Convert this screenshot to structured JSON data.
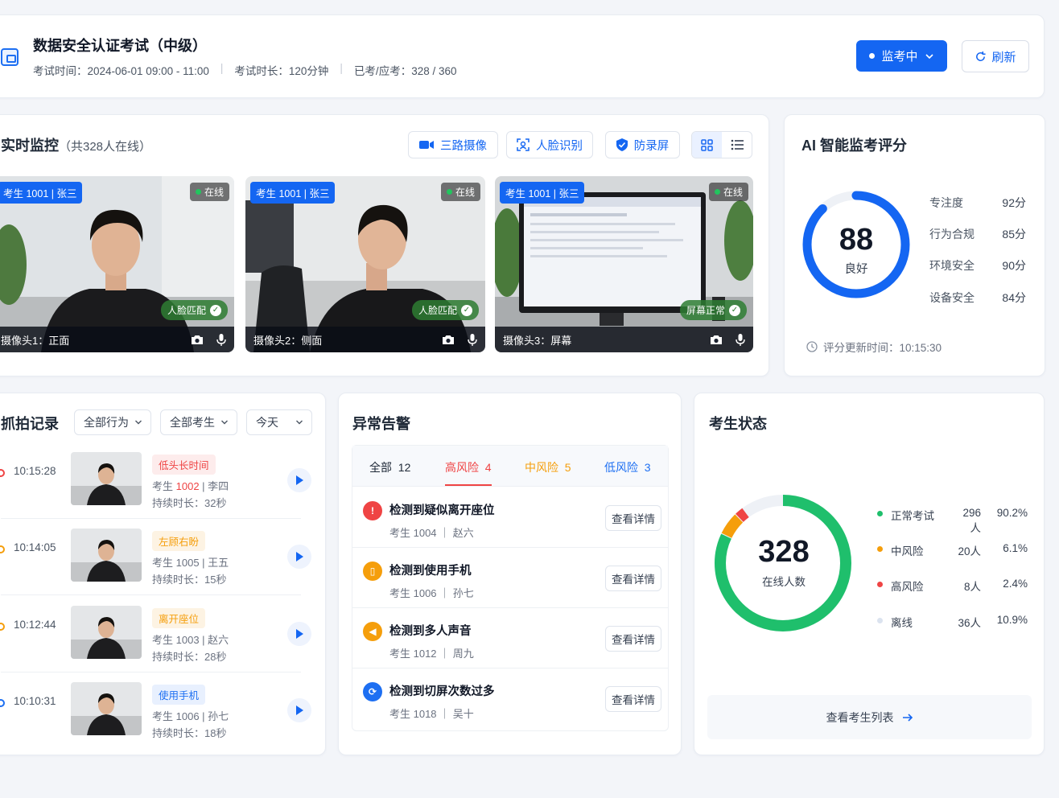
{
  "header": {
    "title": "数据安全认证考试（中级）",
    "meta": [
      "考试时间：2024-06-01 09:00 - 11:00",
      "考试时长：120分钟",
      "已考/应考：328 / 360"
    ],
    "status_label": "监考中",
    "refresh_label": "刷新"
  },
  "monitor": {
    "title": "实时监控",
    "subtitle": "（共328人在线）",
    "tools": [
      "三路摄像",
      "人脸识别",
      "防录屏"
    ],
    "cameras": [
      {
        "tag": "考生 1001 | 张三",
        "status": "在线",
        "check": "人脸匹配",
        "label": "摄像头1：正面"
      },
      {
        "tag": "考生 1001 | 张三",
        "status": "在线",
        "check": "人脸匹配",
        "label": "摄像头2：侧面"
      },
      {
        "tag": "考生 1001 | 张三",
        "status": "在线",
        "check": "屏幕正常",
        "label": "摄像头3：屏幕"
      }
    ]
  },
  "ai_score": {
    "title": "AI 智能监考评分",
    "score": "88",
    "score_value": 88,
    "grade": "良好",
    "items": [
      {
        "name": "专注度",
        "value": "92分"
      },
      {
        "name": "行为合规",
        "value": "85分"
      },
      {
        "name": "环境安全",
        "value": "90分"
      },
      {
        "name": "设备安全",
        "value": "84分"
      }
    ],
    "updated": "评分更新时间：10:15:30"
  },
  "snapshots": {
    "title": "抓拍记录",
    "filters": [
      "全部行为",
      "全部考生",
      "今天"
    ],
    "items": [
      {
        "time": "10:15:28",
        "badge": "低头长时间",
        "badge_color": "#ef4444",
        "badge_bg": "#fdecec",
        "dot_color": "#ef4444",
        "who_prefix": "考生 ",
        "id": "1002",
        "id_color": "#ef4444",
        "who_suffix": " | 李四",
        "duration": "持续时长：32秒"
      },
      {
        "time": "10:14:05",
        "badge": "左顾右盼",
        "badge_color": "#f59e0b",
        "badge_bg": "#fdf3e3",
        "dot_color": "#f59e0b",
        "who_prefix": "考生 ",
        "id": "1005",
        "id_color": "#6b7280",
        "who_suffix": " | 王五",
        "duration": "持续时长：15秒"
      },
      {
        "time": "10:12:44",
        "badge": "离开座位",
        "badge_color": "#f59e0b",
        "badge_bg": "#fdf3e3",
        "dot_color": "#f59e0b",
        "who_prefix": "考生 ",
        "id": "1003",
        "id_color": "#6b7280",
        "who_suffix": " | 赵六",
        "duration": "持续时长：28秒"
      },
      {
        "time": "10:10:31",
        "badge": "使用手机",
        "badge_color": "#1d6ff2",
        "badge_bg": "#e8f0fe",
        "dot_color": "#1d6ff2",
        "who_prefix": "考生 ",
        "id": "1006",
        "id_color": "#6b7280",
        "who_suffix": " | 孙七",
        "duration": "持续时长：18秒"
      }
    ]
  },
  "alerts": {
    "title": "异常告警",
    "tabs": [
      {
        "label": "全部",
        "count": "12",
        "color": "#111827"
      },
      {
        "label": "高风险",
        "count": "4",
        "color": "#ef4444"
      },
      {
        "label": "中风险",
        "count": "5",
        "color": "#f59e0b"
      },
      {
        "label": "低风险",
        "count": "3",
        "color": "#1d6ff2"
      }
    ],
    "items": [
      {
        "title": "检测到疑似离开座位",
        "sub": "考生 1004 ｜ 赵六",
        "icon_color": "#ef4444",
        "action": "查看详情"
      },
      {
        "title": "检测到使用手机",
        "sub": "考生 1006 ｜ 孙七",
        "icon_color": "#f59e0b",
        "action": "查看详情"
      },
      {
        "title": "检测到多人声音",
        "sub": "考生 1012 ｜ 周九",
        "icon_color": "#f59e0b",
        "action": "查看详情"
      },
      {
        "title": "检测到切屏次数过多",
        "sub": "考生 1018 ｜ 吴十",
        "icon_color": "#1d6ff2",
        "action": "查看详情"
      }
    ]
  },
  "exam_status": {
    "title": "考生状态",
    "total": "328",
    "total_label": "在线人数",
    "legend": [
      {
        "name": "正常考试",
        "count": "296人",
        "pct": "90.2%",
        "color": "#1fbf6c",
        "value": 296
      },
      {
        "name": "中风险",
        "count": "20人",
        "pct": "6.1%",
        "color": "#f59e0b",
        "value": 20
      },
      {
        "name": "高风险",
        "count": "8人",
        "pct": "2.4%",
        "color": "#ef4444",
        "value": 8
      },
      {
        "name": "离线",
        "count": "36人",
        "pct": "10.9%",
        "color": "#dbe3ef",
        "value": 36
      }
    ],
    "list_button": "查看考生列表"
  }
}
